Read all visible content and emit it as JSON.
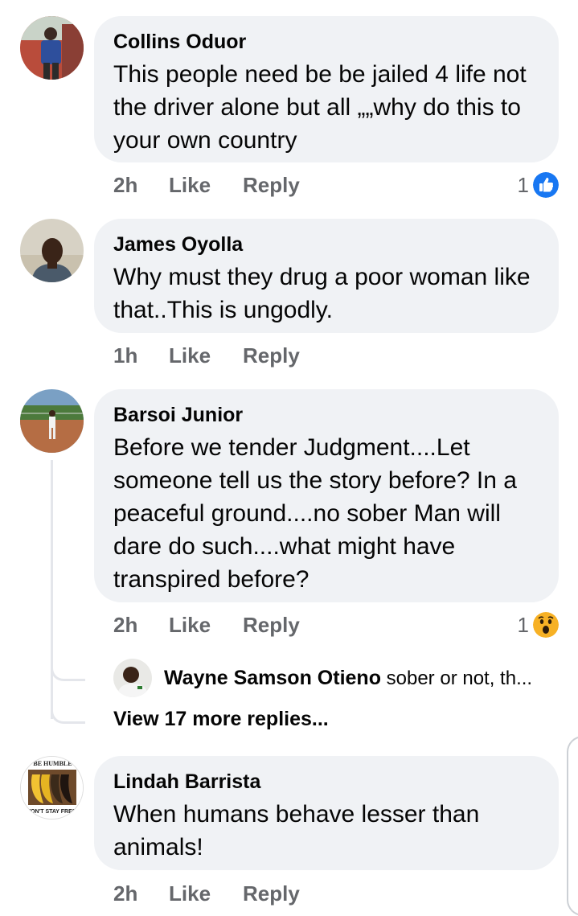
{
  "comments": [
    {
      "name": "Collins Oduor",
      "text": "This people need be be jailed 4 life not the driver alone but all „„why do this to your own country",
      "time": "2h",
      "like": "Like",
      "reply": "Reply",
      "reaction": {
        "count": "1",
        "icon": "like-icon",
        "color": "#1877f2"
      }
    },
    {
      "name": "James Oyolla",
      "text": "Why must they drug a poor woman like that..This is ungodly.",
      "time": "1h",
      "like": "Like",
      "reply": "Reply"
    },
    {
      "name": "Barsoi Junior",
      "text": "Before we tender Judgment....Let someone tell us the story before? In a peaceful ground....no sober Man will dare do such....what might have transpired before?",
      "time": "2h",
      "like": "Like",
      "reply": "Reply",
      "reaction": {
        "count": "1",
        "icon": "wow-icon",
        "color": "#f7b125"
      },
      "reply_preview": {
        "name": "Wayne Samson Otieno",
        "snippet": "sober or not, th..."
      },
      "view_more": "View 17 more replies..."
    },
    {
      "name": "Lindah Barrista",
      "text": "When humans behave lesser than animals!",
      "time": "2h",
      "like": "Like",
      "reply": "Reply",
      "avatar_text": {
        "top": "BE HUMBLE",
        "bottom": "WON'T STAY FRESH"
      }
    }
  ]
}
